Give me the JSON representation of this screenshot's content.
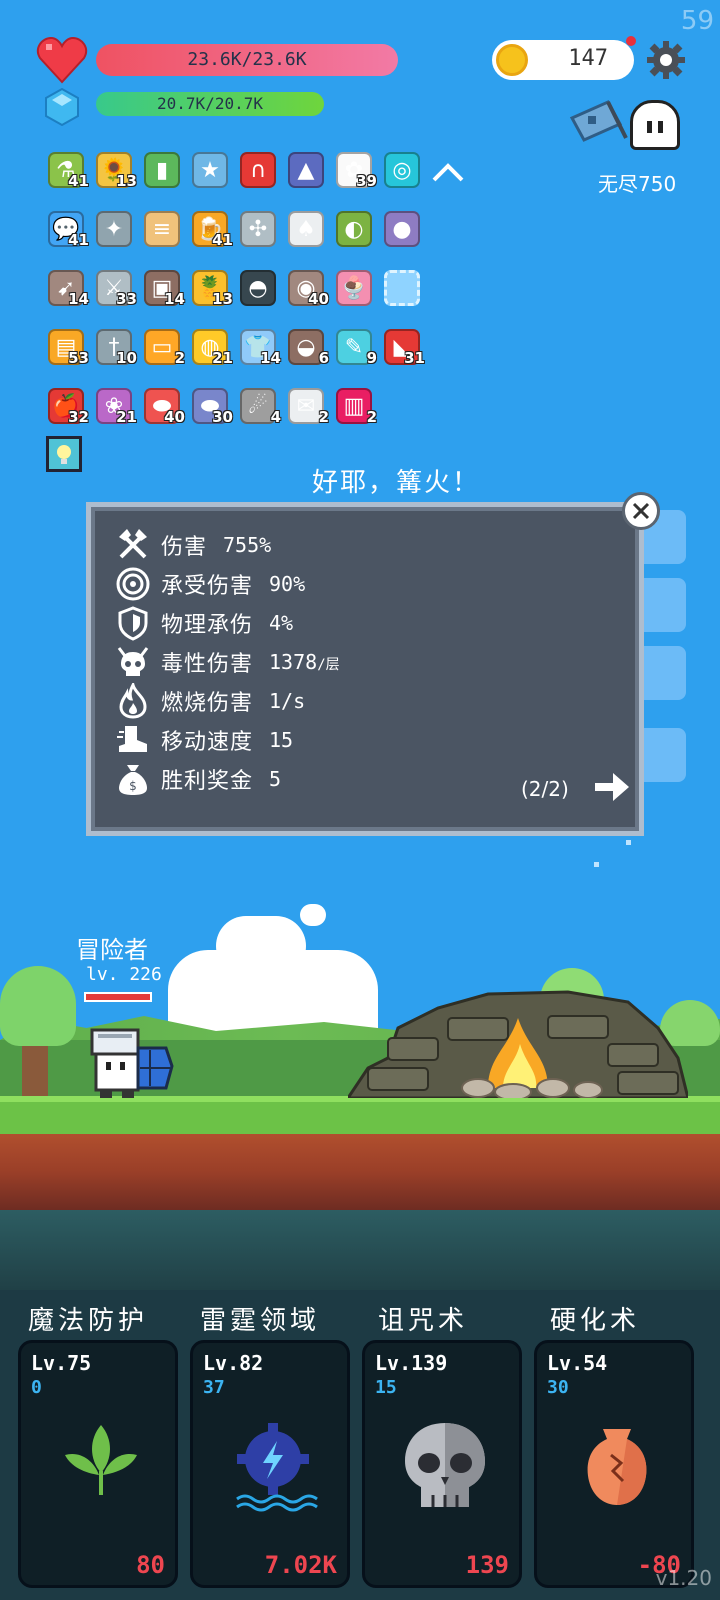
{
  "fps": "59",
  "hud": {
    "hp_text": "23.6K/23.6K",
    "mp_text": "20.7K/20.7K",
    "coins": "147",
    "endless_label": "无尽750"
  },
  "items": [
    {
      "icon": "potion-icon",
      "glyph": "⚗",
      "color": "#8bc34a",
      "count": "41"
    },
    {
      "icon": "sunflower-icon",
      "glyph": "🌻",
      "color": "#f4c542",
      "count": "13"
    },
    {
      "icon": "card-icon",
      "glyph": "▮",
      "color": "#5cb85c",
      "count": ""
    },
    {
      "icon": "id-card-icon",
      "glyph": "★",
      "color": "#6fb7e6",
      "count": ""
    },
    {
      "icon": "magnet-icon",
      "glyph": "∩",
      "color": "#e53935",
      "count": ""
    },
    {
      "icon": "wizard-hat-icon",
      "glyph": "▲",
      "color": "#5c6bc0",
      "count": ""
    },
    {
      "icon": "daisy-icon",
      "glyph": "✿",
      "color": "#fafafa",
      "count": "39"
    },
    {
      "icon": "target-icon",
      "glyph": "◎",
      "color": "#26c6da",
      "count": ""
    },
    {
      "icon": "chat-icon",
      "glyph": "💬",
      "color": "#42a5f5",
      "count": "41"
    },
    {
      "icon": "compass-icon",
      "glyph": "✦",
      "color": "#90a4ae",
      "count": ""
    },
    {
      "icon": "scroll-icon",
      "glyph": "≡",
      "color": "#f0c27b",
      "count": ""
    },
    {
      "icon": "beer-icon",
      "glyph": "🍺",
      "color": "#f9a825",
      "count": "41"
    },
    {
      "icon": "shuriken-icon",
      "glyph": "✣",
      "color": "#b0bec5",
      "count": ""
    },
    {
      "icon": "playing-cards-icon",
      "glyph": "♠",
      "color": "#eceff1",
      "count": ""
    },
    {
      "icon": "lime-icon",
      "glyph": "◐",
      "color": "#7cb342",
      "count": ""
    },
    {
      "icon": "grapes-icon",
      "glyph": "●",
      "color": "#8e7cc3",
      "count": ""
    },
    {
      "icon": "crossbow-icon",
      "glyph": "➹",
      "color": "#a1887f",
      "count": "14"
    },
    {
      "icon": "sword-icon",
      "glyph": "⚔",
      "color": "#b0bec5",
      "count": "33"
    },
    {
      "icon": "door-icon",
      "glyph": "▣",
      "color": "#8d6e63",
      "count": "14"
    },
    {
      "icon": "pineapple-icon",
      "glyph": "🍍",
      "color": "#fbc02d",
      "count": "13"
    },
    {
      "icon": "cauldron-icon",
      "glyph": "◓",
      "color": "#37474f",
      "count": ""
    },
    {
      "icon": "shield-round-icon",
      "glyph": "◉",
      "color": "#a1887f",
      "count": "40"
    },
    {
      "icon": "ice-cream-icon",
      "glyph": "🍨",
      "color": "#f48fb1",
      "count": ""
    },
    {
      "icon": "empty-slot-icon",
      "glyph": "",
      "color": "#8fd3ff",
      "count": ""
    },
    {
      "icon": "book-icon",
      "glyph": "▤",
      "color": "#f9a825",
      "count": "53"
    },
    {
      "icon": "dagger-icon",
      "glyph": "†",
      "color": "#90a4ae",
      "count": "10"
    },
    {
      "icon": "briefcase-icon",
      "glyph": "▭",
      "color": "#ffa726",
      "count": "2"
    },
    {
      "icon": "durian-icon",
      "glyph": "◍",
      "color": "#ffca28",
      "count": "21"
    },
    {
      "icon": "shirt-icon",
      "glyph": "👕",
      "color": "#90caf9",
      "count": "14"
    },
    {
      "icon": "coconut-drink-icon",
      "glyph": "◒",
      "color": "#8d6e63",
      "count": "6"
    },
    {
      "icon": "syringe-icon",
      "glyph": "✎",
      "color": "#4dd0e1",
      "count": "9"
    },
    {
      "icon": "watermelon-icon",
      "glyph": "◣",
      "color": "#e53935",
      "count": "31"
    },
    {
      "icon": "apple-icon",
      "glyph": "🍎",
      "color": "#e53935",
      "count": "32"
    },
    {
      "icon": "tulip-icon",
      "glyph": "❀",
      "color": "#ba68c8",
      "count": "21"
    },
    {
      "icon": "pill-red-icon",
      "glyph": "⬬",
      "color": "#ef5350",
      "count": "40"
    },
    {
      "icon": "pill-blue-icon",
      "glyph": "⬬",
      "color": "#7986cb",
      "count": "30"
    },
    {
      "icon": "meteor-icon",
      "glyph": "☄",
      "color": "#9e9e9e",
      "count": "4"
    },
    {
      "icon": "envelope-icon",
      "glyph": "✉",
      "color": "#eceff1",
      "count": "2"
    },
    {
      "icon": "jam-jar-icon",
      "glyph": "▥",
      "color": "#e91e63",
      "count": "2"
    }
  ],
  "bonfire_title": "好耶，篝火！",
  "stats": [
    {
      "icon": "crossed-axes-icon",
      "label": "伤害",
      "value": "755%",
      "unit": ""
    },
    {
      "icon": "target-ring-icon",
      "label": "承受伤害",
      "value": "90%",
      "unit": ""
    },
    {
      "icon": "shield-icon",
      "label": "物理承伤",
      "value": "4%",
      "unit": ""
    },
    {
      "icon": "poison-skull-icon",
      "label": "毒性伤害",
      "value": "1378",
      "unit": "/层"
    },
    {
      "icon": "flame-icon",
      "label": "燃烧伤害",
      "value": "1/s",
      "unit": ""
    },
    {
      "icon": "boot-icon",
      "label": "移动速度",
      "value": "15",
      "unit": ""
    },
    {
      "icon": "money-bag-icon",
      "label": "胜利奖金",
      "value": "5",
      "unit": ""
    }
  ],
  "panel_page": "(2/2)",
  "player": {
    "name": "冒险者",
    "level": "lv. 226"
  },
  "skills": [
    {
      "title": "魔法防护",
      "level": "Lv.75",
      "cost": "0",
      "value": "80",
      "icon": "leaf-icon"
    },
    {
      "title": "雷霆领域",
      "level": "Lv.82",
      "cost": "37",
      "value": "7.02K",
      "icon": "thunder-gear-icon"
    },
    {
      "title": "诅咒术",
      "level": "Lv.139",
      "cost": "15",
      "value": "139",
      "icon": "skull-icon"
    },
    {
      "title": "硬化术",
      "level": "Lv.54",
      "cost": "30",
      "value": "-80",
      "icon": "cracked-vase-icon"
    }
  ],
  "version": "v1.20"
}
